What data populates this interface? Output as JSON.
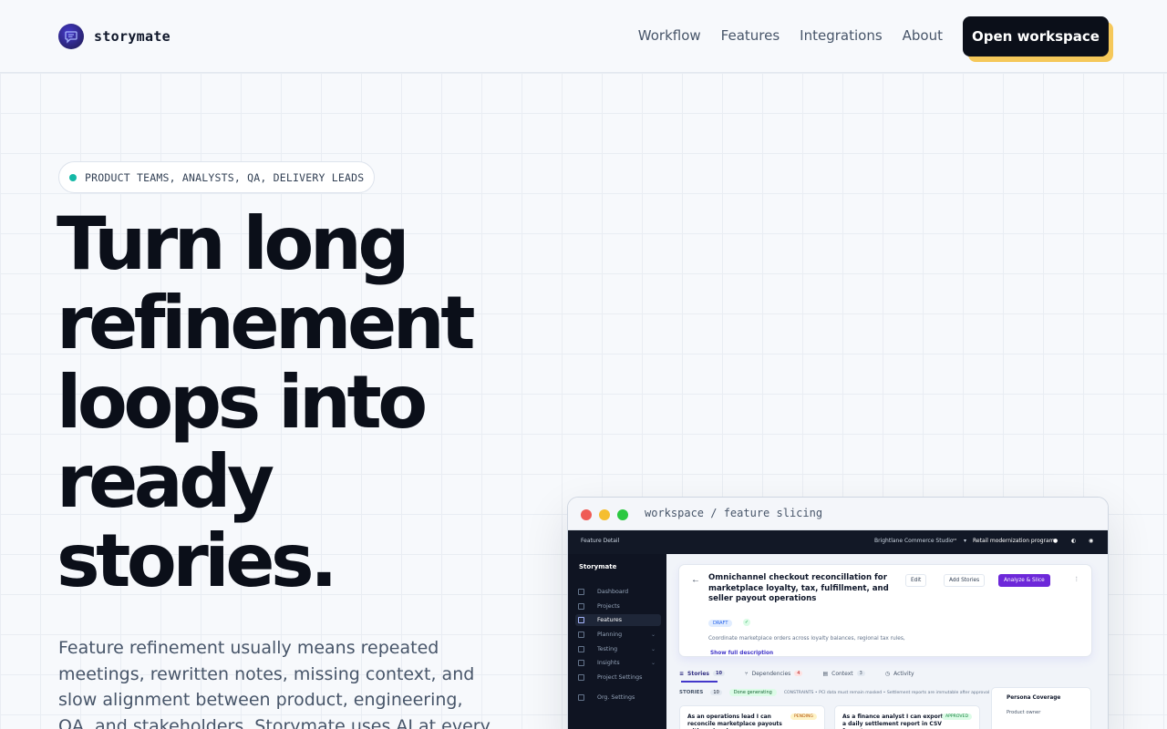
{
  "brand": {
    "name": "storymate"
  },
  "nav": {
    "items": [
      "Workflow",
      "Features",
      "Integrations",
      "About"
    ],
    "cta": "Open workspace"
  },
  "hero": {
    "eyebrow": "PRODUCT TEAMS, ANALYSTS, QA, DELIVERY LEADS",
    "headline": "Turn long refinement loops into ready stories.",
    "lede": "Feature refinement usually means repeated meetings, rewritten notes, missing context, and slow alignment between product, engineering, QA, and stakeholders. Storymate uses AI at every step to turn that shared"
  },
  "workspace": {
    "window_title": "workspace / feature slicing",
    "topbar": {
      "left": "Feature Detail",
      "org": "Brightlane Commerce Studio",
      "program": "Retail modernization program"
    },
    "sidebar": {
      "brand": "Storymate",
      "items": [
        {
          "label": "Dashboard"
        },
        {
          "label": "Projects"
        },
        {
          "label": "Features"
        },
        {
          "label": "Planning"
        },
        {
          "label": "Testing"
        },
        {
          "label": "Insights"
        },
        {
          "label": "Project Settings"
        },
        {
          "label": "Org. Settings"
        }
      ]
    },
    "feature": {
      "title": "Omnichannel checkout reconcillation for marketplace loyalty, tax, fulfillment, and seller payout operations",
      "edit": "Edit",
      "add_stories": "Add Stories",
      "analyze": "Analyze & Slice",
      "status": "DRAFT",
      "description": "Coordinate marketplace orders across loyalty balances, regional tax rules,",
      "show_more": "Show full description"
    },
    "tabs": [
      {
        "label": "Stories",
        "count": "10"
      },
      {
        "label": "Dependencies",
        "count": "4"
      },
      {
        "label": "Context",
        "count": "3"
      },
      {
        "label": "Activity",
        "count": ""
      }
    ],
    "stories_label": "STORIES",
    "stories_count": "10",
    "done_generating": "Done generating",
    "constraints": "CONSTRAINTS • PCI data must remain masked • Settlement reports are immutable after approval",
    "stories": [
      {
        "text": "As an operations lead I can reconcile marketplace payouts with regional",
        "badge": "PENDING"
      },
      {
        "text": "As a finance analyst I can export a daily settlement report in CSV format",
        "badge": "APPROVED"
      }
    ],
    "persona": {
      "title": "Persona Coverage",
      "item": "Product owner"
    }
  }
}
